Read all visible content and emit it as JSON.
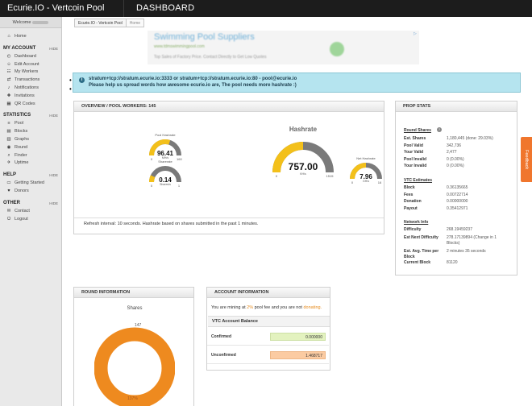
{
  "topbar": {
    "brand": "Ecurie.IO - Vertcoin Pool",
    "page": "DASHBOARD"
  },
  "sidebar": {
    "welcome": "Welcome",
    "home": {
      "icon": "home-icon",
      "label": "Home"
    },
    "sections": [
      {
        "title": "MY ACCOUNT",
        "hide": "HIDE",
        "items": [
          {
            "icon": "gauge-icon",
            "label": "Dashboard"
          },
          {
            "icon": "person-icon",
            "label": "Edit Account"
          },
          {
            "icon": "workers-icon",
            "label": "My Workers"
          },
          {
            "icon": "transactions-icon",
            "label": "Transactions"
          },
          {
            "icon": "bell-icon",
            "label": "Notifications"
          },
          {
            "icon": "plus-icon",
            "label": "Invitations"
          },
          {
            "icon": "qr-code-icon",
            "label": "QR Codes"
          }
        ]
      },
      {
        "title": "STATISTICS",
        "hide": "HIDE",
        "items": [
          {
            "icon": "pool-icon",
            "label": "Pool"
          },
          {
            "icon": "blocks-icon",
            "label": "Blocks"
          },
          {
            "icon": "graph-icon",
            "label": "Graphs"
          },
          {
            "icon": "round-icon",
            "label": "Round"
          },
          {
            "icon": "search-icon",
            "label": "Finder"
          },
          {
            "icon": "uptime-icon",
            "label": "Uptime"
          }
        ]
      },
      {
        "title": "HELP",
        "hide": "HIDE",
        "items": [
          {
            "icon": "book-icon",
            "label": "Getting Started"
          },
          {
            "icon": "donate-icon",
            "label": "Donors"
          }
        ]
      },
      {
        "title": "OTHER",
        "hide": "HIDE",
        "items": [
          {
            "icon": "envelope-icon",
            "label": "Contact"
          },
          {
            "icon": "power-icon",
            "label": "Logout"
          }
        ]
      }
    ]
  },
  "breadcrumb": [
    "Ecurie.IO - Vertcoin Pool",
    "Home"
  ],
  "ad": {
    "title": "Swimming Pool Suppliers",
    "url": "www.tdmswimmingpool.com",
    "desc": "Top Sales of Factory Price. Contact Directly to Get Low Quotes"
  },
  "info": {
    "line1": "stratum+tcp://stratum.ecurie.io:3333 or stratum+tcp://stratum.ecurie.io:80 - pool@ecurie.io",
    "line2": "Please help us spread words how awesome ecurie.io are, The pool needs more hashrate :)"
  },
  "overview": {
    "title": "OVERVIEW / POOL WORKERS: 145",
    "hashrate_title": "Hashrate",
    "refresh": "Refresh interval: 10 seconds. Hashrate based on shares submitted in the past 1 minutes.",
    "gauges": {
      "pool": {
        "label": "Pool Hashrate",
        "value": "96.41",
        "unit": "MH/s",
        "min": "0",
        "max": "160",
        "fraction": 0.6
      },
      "hashrate": {
        "value": "757.00",
        "unit": "KH/s",
        "min": "0",
        "max": "1515",
        "fraction": 0.5
      },
      "sharerate": {
        "label": "Sharerate",
        "value": "0.14",
        "unit": "Shares/s",
        "min": "0",
        "max": "1",
        "fraction": 0.14
      },
      "net": {
        "label": "Net Hashrate",
        "value": "7.96",
        "unit": "GH/s",
        "min": "0",
        "max": "16",
        "fraction": 0.5
      }
    }
  },
  "prop": {
    "title": "PROP STATS",
    "round_title": "Round Shares",
    "round": [
      {
        "k": "Est. Shares",
        "v": "1,180,445 (done: 29.03%)"
      },
      {
        "k": "Pool Valid",
        "v": "342,736"
      },
      {
        "k": "Your Valid",
        "v": "2,477"
      },
      {
        "k": "Pool Invalid",
        "v": "0 (0.00%)"
      },
      {
        "k": "Your Invalid",
        "v": "0 (0.00%)"
      }
    ],
    "est_title": "VTC Estimates",
    "est": [
      {
        "k": "Block",
        "v": "0.36135665"
      },
      {
        "k": "Fees",
        "v": "0.00722714"
      },
      {
        "k": "Donation",
        "v": "0.00000000"
      },
      {
        "k": "Payout",
        "v": "0.35412971"
      }
    ],
    "net_title": "Network Info",
    "net": [
      {
        "k": "Difficulty",
        "v": "268.19459237"
      },
      {
        "k": "Est Next Difficulty",
        "v": "278.17139894 (Change in 1 Blocks)"
      },
      {
        "k": "Est. Avg. Time per Block",
        "v": "2 minutes 35 seconds"
      },
      {
        "k": "Current Block",
        "v": "81120"
      }
    ]
  },
  "round_info": {
    "title": "ROUND INFORMATION",
    "chart_title": "Shares",
    "top_label": "147",
    "bottom_label": "137%"
  },
  "account": {
    "title": "ACCOUNT INFORMATION",
    "mining_pre": "You are mining at",
    "fee": "2%",
    "mining_mid": "pool fee and you are not",
    "donating": "donating.",
    "balance_title": "VTC Account Balance",
    "confirmed_label": "Confirmed",
    "confirmed": "0.000000",
    "unconfirmed_label": "Unconfirmed",
    "unconfirmed": "1.468717"
  },
  "feedback": "Feedback",
  "colors": {
    "gauge_fill": "#f3c01a",
    "gauge_track": "#7a7a7a",
    "donut": "#ee8a1f",
    "info_bg": "#b5e4ef",
    "confirmed_bg": "#e3f2bf",
    "unconfirmed_bg": "#fbcba2"
  }
}
